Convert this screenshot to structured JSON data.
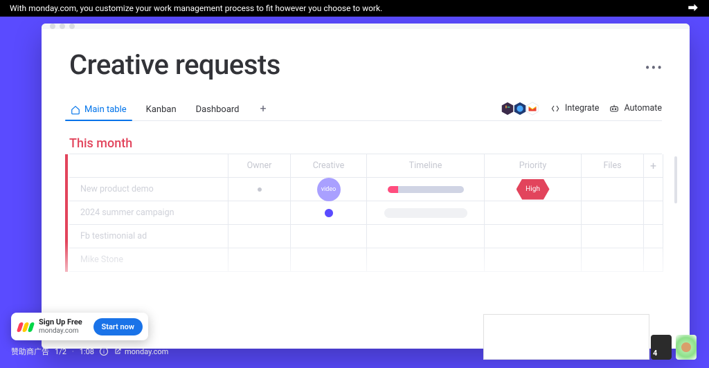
{
  "topbar": {
    "caption": "With monday.com, you customize your work management process to fit however you choose to work."
  },
  "board": {
    "title": "Creative requests",
    "tabs": {
      "main": "Main table",
      "kanban": "Kanban",
      "dashboard": "Dashboard"
    },
    "tools": {
      "integrate": "Integrate",
      "automate": "Automate"
    },
    "group_title": "This month",
    "columns": {
      "owner": "Owner",
      "creative": "Creative",
      "timeline": "Timeline",
      "priority": "Priority",
      "files": "Files"
    },
    "rows": [
      {
        "name": "New product demo",
        "creative_label": "video",
        "priority_label": "High"
      },
      {
        "name": "2024 summer campaign"
      },
      {
        "name": "Fb testimonial ad"
      },
      {
        "name": "Mike Stone"
      }
    ]
  },
  "sponsor": {
    "headline": "Sign Up Free",
    "domain": "monday.com",
    "cta": "Start now"
  },
  "adinfo": {
    "label": "赞助商广告",
    "progress": "1/2",
    "time": "1:08",
    "site": "monday.com"
  },
  "thumbs": {
    "count_badge": "4"
  }
}
